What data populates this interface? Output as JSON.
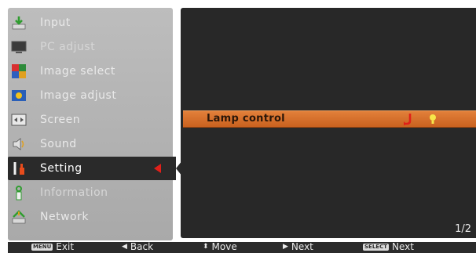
{
  "sidebar": {
    "items": [
      {
        "label": "Input",
        "icon": "input-icon"
      },
      {
        "label": "PC adjust",
        "icon": "pc-adjust-icon"
      },
      {
        "label": "Image select",
        "icon": "image-select-icon"
      },
      {
        "label": "Image adjust",
        "icon": "image-adjust-icon"
      },
      {
        "label": "Screen",
        "icon": "screen-icon"
      },
      {
        "label": "Sound",
        "icon": "sound-icon"
      },
      {
        "label": "Setting",
        "icon": "setting-icon",
        "active": true
      },
      {
        "label": "Information",
        "icon": "information-icon"
      },
      {
        "label": "Network",
        "icon": "network-icon"
      }
    ]
  },
  "main": {
    "selected_row": {
      "label": "Lamp control"
    },
    "page_indicator": "1/2"
  },
  "hints": {
    "exit_key": "MENU",
    "exit_label": "Exit",
    "back_label": "Back",
    "move_label": "Move",
    "next_label": "Next",
    "select_key": "SELECT",
    "select_next_label": "Next"
  },
  "colors": {
    "highlight": "#d8702c",
    "active_marker": "#e0201a",
    "panel": "#282828",
    "sidebar": "#b4b4b4"
  }
}
